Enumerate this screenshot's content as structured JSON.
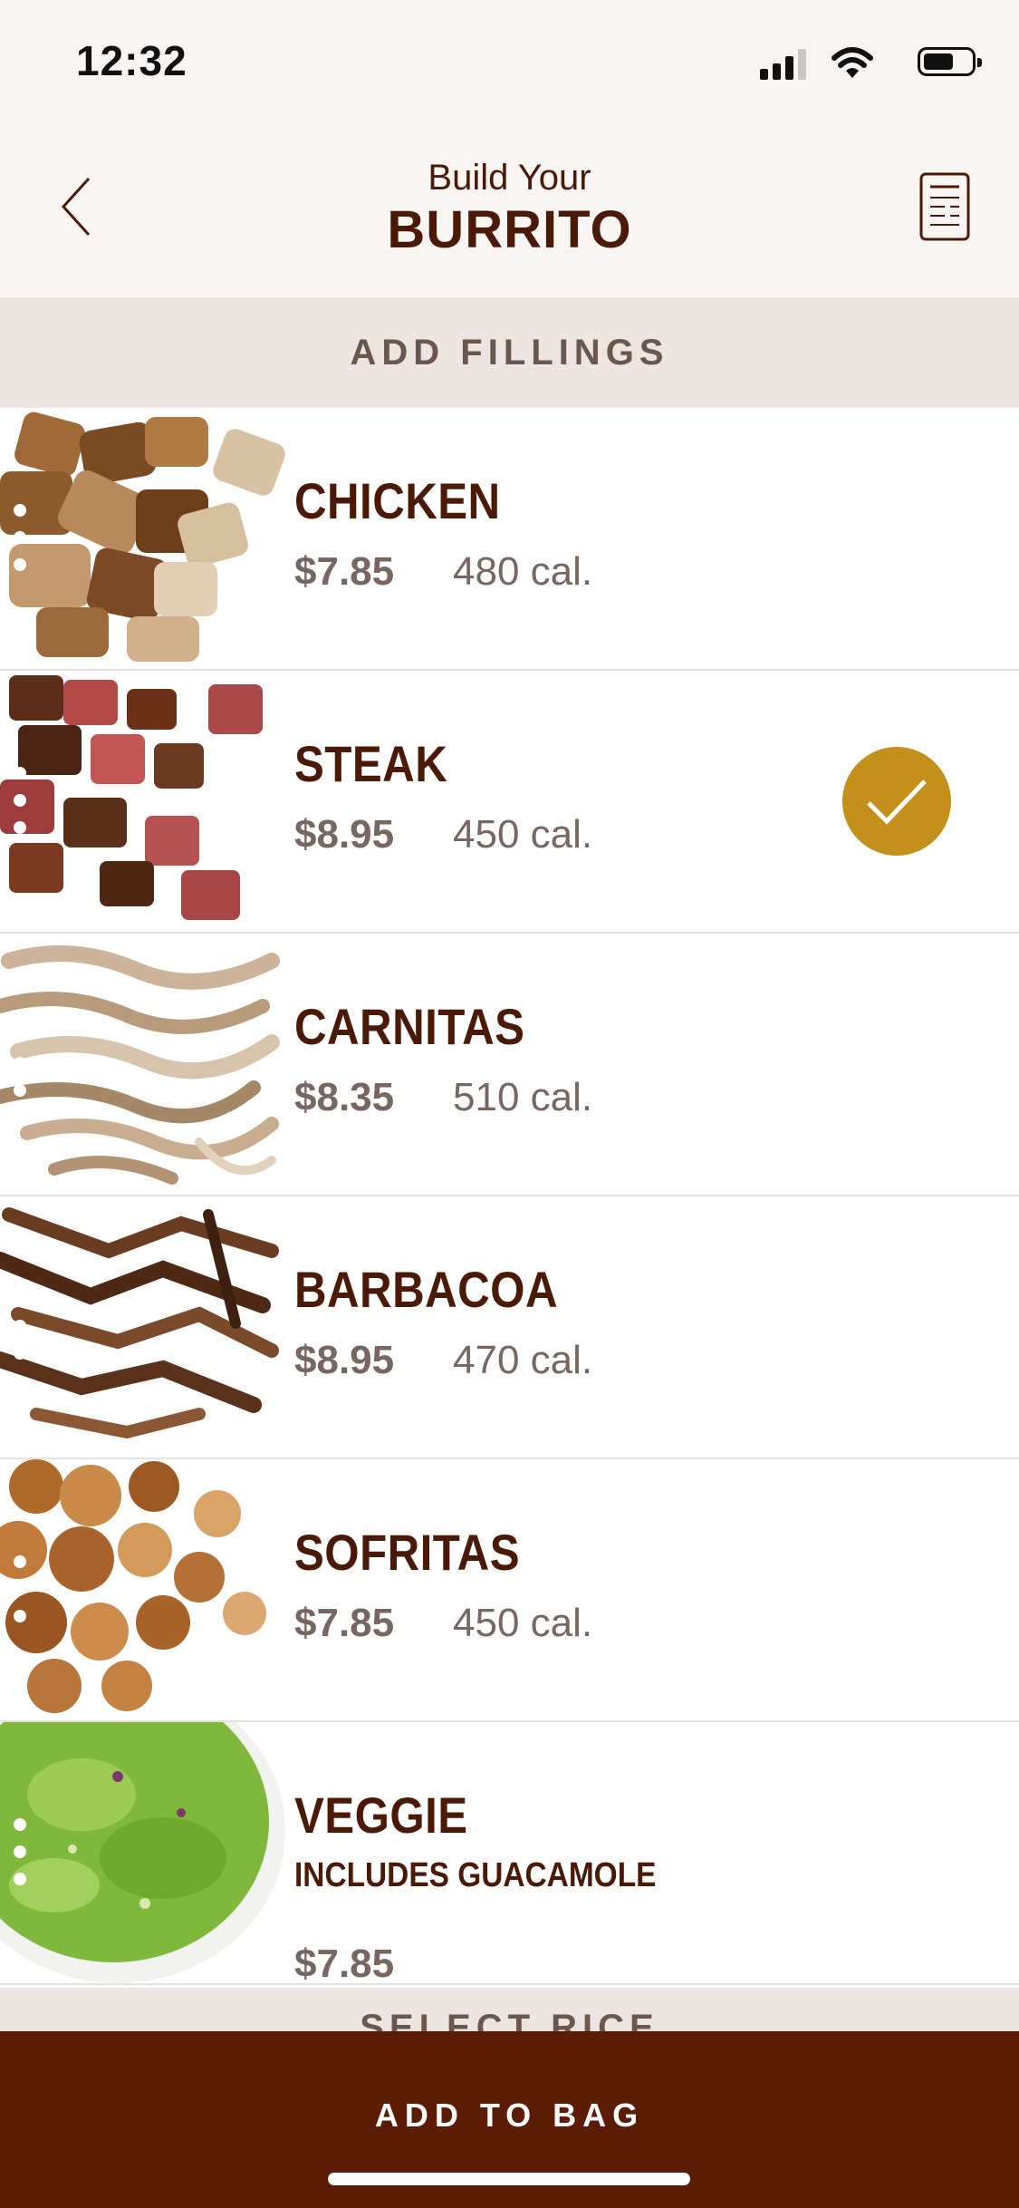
{
  "status_bar": {
    "time": "12:32"
  },
  "header": {
    "title_small": "Build Your",
    "title_large": "BURRITO"
  },
  "section": {
    "label": "ADD FILLINGS",
    "next_label": "SELECT RICE"
  },
  "fillings": [
    {
      "name": "CHICKEN",
      "price": "$7.85",
      "calories": "480 cal.",
      "selected": false
    },
    {
      "name": "STEAK",
      "price": "$8.95",
      "calories": "450 cal.",
      "selected": true
    },
    {
      "name": "CARNITAS",
      "price": "$8.35",
      "calories": "510 cal.",
      "selected": false
    },
    {
      "name": "BARBACOA",
      "price": "$8.95",
      "calories": "470 cal.",
      "selected": false
    },
    {
      "name": "SOFRITAS",
      "price": "$7.85",
      "calories": "450 cal.",
      "selected": false
    },
    {
      "name": "VEGGIE",
      "subtitle": "INCLUDES GUACAMOLE",
      "price": "$7.85",
      "selected": false
    }
  ],
  "bottom_bar": {
    "label": "ADD TO BAG"
  },
  "colors": {
    "brand_brown": "#4a1a06",
    "bar_brown": "#5a1c05",
    "check_gold": "#c4901c",
    "section_bg": "#ede5e1"
  },
  "icons": [
    "back-chevron-icon",
    "nutrition-menu-icon",
    "checkmark-icon",
    "signal-icon",
    "wifi-icon",
    "battery-icon"
  ]
}
